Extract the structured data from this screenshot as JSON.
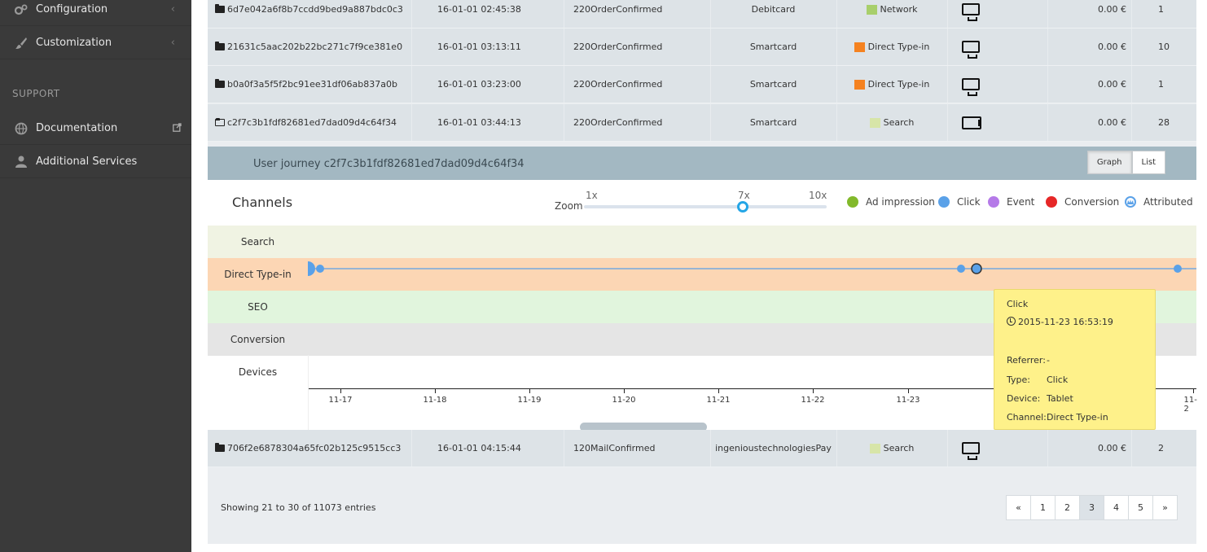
{
  "sidebar": {
    "items": [
      {
        "label": "Configuration",
        "icon": "gears-icon"
      },
      {
        "label": "Customization",
        "icon": "brush-icon"
      }
    ],
    "section_label": "SUPPORT",
    "support_items": [
      {
        "label": "Documentation",
        "icon": "globe-icon"
      },
      {
        "label": "Additional Services",
        "icon": "user-icon"
      }
    ]
  },
  "rows": [
    {
      "id": "6d7e042a6f8b7ccdd9bed9a887bdc0c3",
      "date": "16-01-01 02:45:38",
      "status": "220OrderConfirmed",
      "payment": "Debitcard",
      "channel": "Network",
      "channel_color": "#a8cf6b",
      "device": "monitor",
      "value": "0.00 €",
      "count": "1"
    },
    {
      "id": "21631c5aac202b22bc271c7f9ce381e0",
      "date": "16-01-01 03:13:11",
      "status": "220OrderConfirmed",
      "payment": "Smartcard",
      "channel": "Direct Type-in",
      "channel_color": "#f58220",
      "device": "monitor",
      "value": "0.00 €",
      "count": "10"
    },
    {
      "id": "b0a0f3a5f5f2bc91ee31df06ab837a0b",
      "date": "16-01-01 03:23:00",
      "status": "220OrderConfirmed",
      "payment": "Smartcard",
      "channel": "Direct Type-in",
      "channel_color": "#f58220",
      "device": "monitor",
      "value": "0.00 €",
      "count": "1"
    },
    {
      "id": "c2f7c3b1fdf82681ed7dad09d4c64f34",
      "date": "16-01-01 03:44:13",
      "status": "220OrderConfirmed",
      "payment": "Smartcard",
      "channel": "Search",
      "channel_color": "#d7e5a8",
      "device": "tablet",
      "value": "0.00 €",
      "count": "28"
    }
  ],
  "journey": {
    "title": "User journey c2f7c3b1fdf82681ed7dad09d4c64f34",
    "view_buttons": [
      "Graph",
      "List"
    ],
    "channels_title": "Channels",
    "zoom_label": "Zoom",
    "zoom_ticks": [
      "1x",
      "7x",
      "10x"
    ],
    "zoom_value": "7x",
    "legend": [
      {
        "label": "Ad impression",
        "color": "#82b92b"
      },
      {
        "label": "Click",
        "color": "#5aa1e8"
      },
      {
        "label": "Event",
        "color": "#b57ae8"
      },
      {
        "label": "Conversion",
        "color": "#e62727"
      },
      {
        "label": "Attributed",
        "color": "#5aa1e8"
      }
    ],
    "lanes": [
      {
        "label": "Search",
        "color": "#f0f3e3"
      },
      {
        "label": "Direct Type-in",
        "color": "#fcd6b4"
      },
      {
        "label": "SEO",
        "color": "#e1f5dd"
      },
      {
        "label": "Conversion",
        "color": "#e5e5e5"
      },
      {
        "label": "Devices",
        "color": "#ffffff"
      }
    ],
    "x_ticks": [
      "11-17",
      "11-18",
      "11-19",
      "11-20",
      "11-21",
      "11-22",
      "11-23",
      "11-2"
    ],
    "tooltip": {
      "title": "Click",
      "time": "2015-11-23 16:53:19",
      "fields": [
        {
          "k": "Referrer:",
          "v": "-"
        },
        {
          "k": "Type:",
          "v": "Click"
        },
        {
          "k": "Device:",
          "v": "Tablet"
        },
        {
          "k": "Channel:",
          "v": "Direct Type-in"
        }
      ]
    }
  },
  "last_row": {
    "id": "706f2e6878304a65fc02b125c9515cc3",
    "date": "16-01-01 04:15:44",
    "status": "120MailConfirmed",
    "payment": "ingenioustechnologiesPay",
    "channel": "Search",
    "channel_color": "#d7e5a8",
    "device": "monitor",
    "value": "0.00 €",
    "count": "2"
  },
  "footer": {
    "info": "Showing 21 to 30 of 11073 entries",
    "pages": [
      "«",
      "1",
      "2",
      "3",
      "4",
      "5",
      "»"
    ],
    "active_page": "3"
  }
}
